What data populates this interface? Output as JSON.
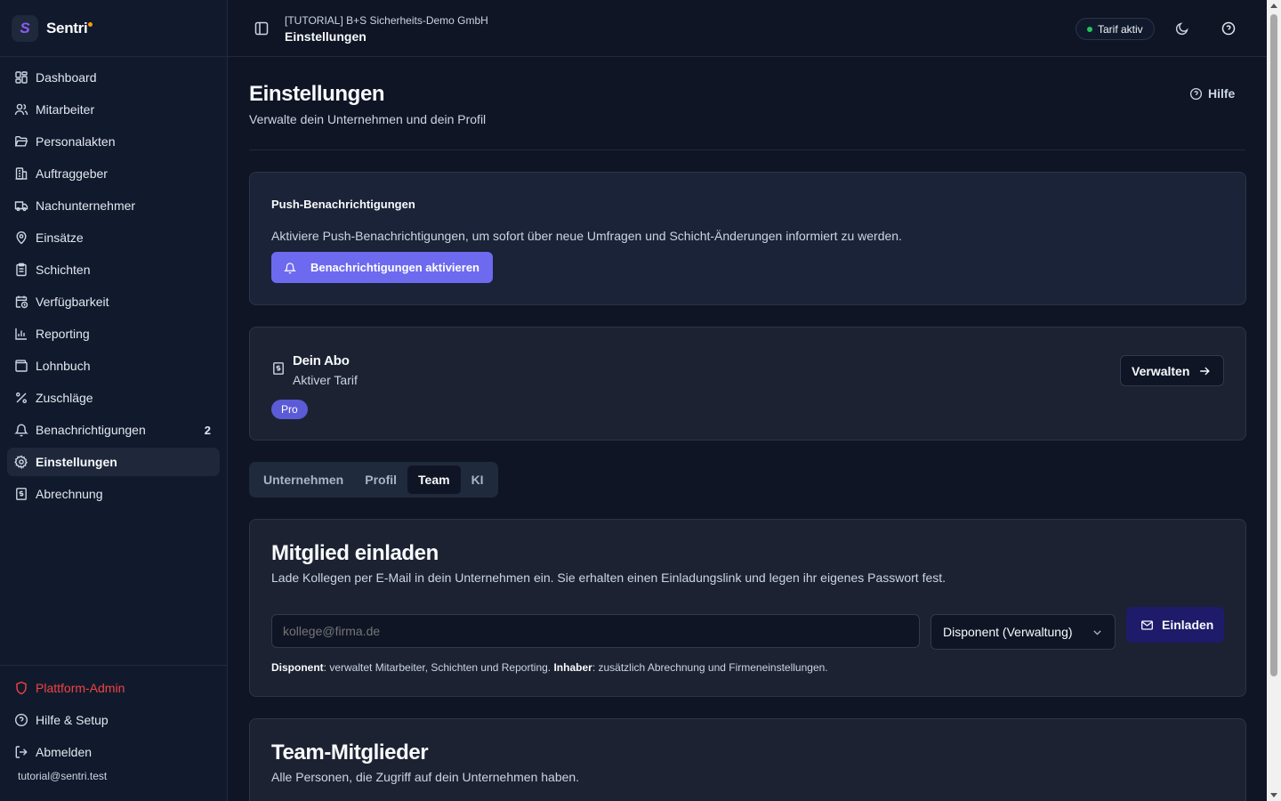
{
  "brand": {
    "logo_letter": "S",
    "name": "Sentri"
  },
  "sidebar": {
    "items": [
      {
        "label": "Dashboard",
        "icon": "dashboard-icon"
      },
      {
        "label": "Mitarbeiter",
        "icon": "users-icon"
      },
      {
        "label": "Personalakten",
        "icon": "folder-icon"
      },
      {
        "label": "Auftraggeber",
        "icon": "building-icon"
      },
      {
        "label": "Nachunternehmer",
        "icon": "truck-icon"
      },
      {
        "label": "Einsätze",
        "icon": "map-pin-icon"
      },
      {
        "label": "Schichten",
        "icon": "clipboard-icon"
      },
      {
        "label": "Verfügbarkeit",
        "icon": "calendar-clock-icon"
      },
      {
        "label": "Reporting",
        "icon": "bar-chart-icon"
      },
      {
        "label": "Lohnbuch",
        "icon": "wallet-icon"
      },
      {
        "label": "Zuschläge",
        "icon": "percent-icon"
      },
      {
        "label": "Benachrichtigungen",
        "icon": "bell-icon",
        "badge": "2"
      },
      {
        "label": "Einstellungen",
        "icon": "gear-icon",
        "active": true
      },
      {
        "label": "Abrechnung",
        "icon": "receipt-icon"
      }
    ],
    "bottom": {
      "admin": "Plattform-Admin",
      "help": "Hilfe & Setup",
      "logout": "Abmelden",
      "email": "tutorial@sentri.test"
    }
  },
  "header": {
    "company": "[TUTORIAL] B+S Sicherheits-Demo GmbH",
    "title": "Einstellungen",
    "tarif": "Tarif aktiv"
  },
  "page": {
    "title": "Einstellungen",
    "subtitle": "Verwalte dein Unternehmen und dein Profil",
    "help": "Hilfe"
  },
  "push": {
    "title": "Push-Benachrichtigungen",
    "text": "Aktiviere Push-Benachrichtigungen, um sofort über neue Umfragen und Schicht-Änderungen informiert zu werden.",
    "button": "Benachrichtigungen aktivieren"
  },
  "abo": {
    "title": "Dein Abo",
    "subtitle": "Aktiver Tarif",
    "plan": "Pro",
    "manage": "Verwalten"
  },
  "tabs": [
    {
      "label": "Unternehmen"
    },
    {
      "label": "Profil"
    },
    {
      "label": "Team",
      "active": true
    },
    {
      "label": "KI"
    }
  ],
  "invite": {
    "title": "Mitglied einladen",
    "subtitle": "Lade Kollegen per E-Mail in dein Unternehmen ein. Sie erhalten einen Einladungslink und legen ihr eigenes Passwort fest.",
    "email_placeholder": "kollege@firma.de",
    "role_value": "Disponent (Verwaltung)",
    "button": "Einladen",
    "note_role1": "Disponent",
    "note_text1": ": verwaltet Mitarbeiter, Schichten und Reporting. ",
    "note_role2": "Inhaber",
    "note_text2": ": zusätzlich Abrechnung und Firmeneinstellungen."
  },
  "team": {
    "title": "Team-Mitglieder",
    "subtitle": "Alle Personen, die Zugriff auf dein Unternehmen haben."
  },
  "colors": {
    "accent": "#6d6af0",
    "active_dot": "#22c55e",
    "danger": "#ef4444",
    "brand_dot": "#f59e0b"
  }
}
